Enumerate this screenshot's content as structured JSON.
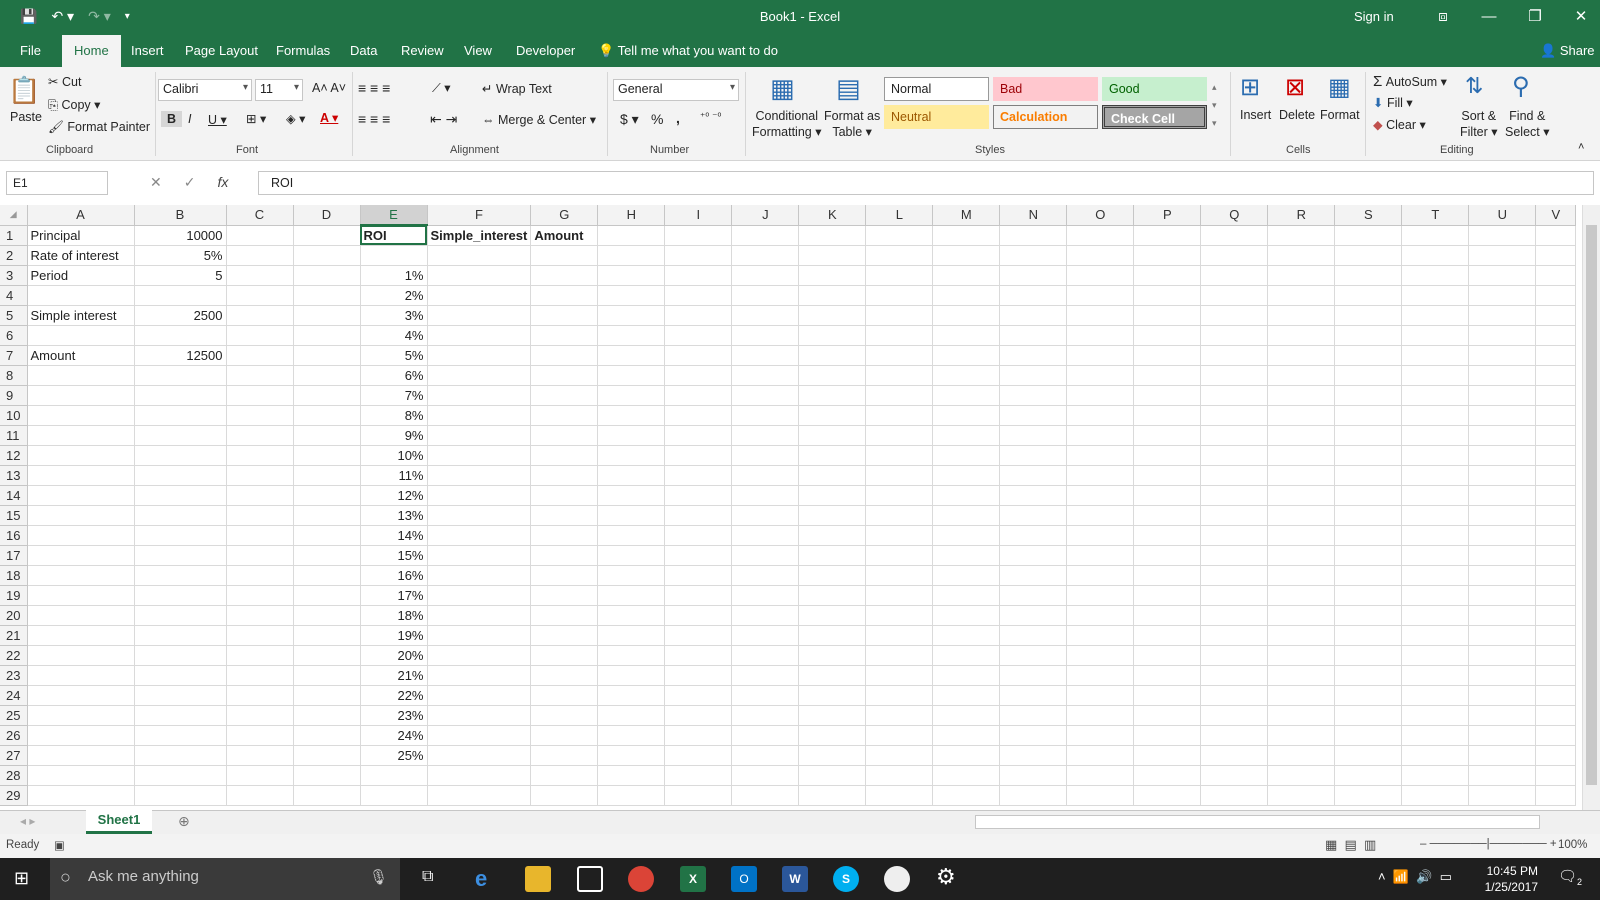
{
  "app": {
    "title": "Book1  -  Excel",
    "signin": "Sign in",
    "share": "Share"
  },
  "tabs": [
    "File",
    "Home",
    "Insert",
    "Page Layout",
    "Formulas",
    "Data",
    "Review",
    "View",
    "Developer"
  ],
  "tell_me": "Tell me what you want to do",
  "ribbon": {
    "clipboard": {
      "paste": "Paste",
      "cut": "Cut",
      "copy": "Copy",
      "format_painter": "Format Painter",
      "label": "Clipboard"
    },
    "font": {
      "name": "Calibri",
      "size": "11",
      "label": "Font"
    },
    "alignment": {
      "wrap": "Wrap Text",
      "merge": "Merge & Center",
      "label": "Alignment"
    },
    "number": {
      "format": "General",
      "label": "Number",
      "dollar": "$",
      "percent": "%",
      "comma": ","
    },
    "styles": {
      "conditional": "Conditional",
      "formatting": "Formatting",
      "format_as": "Format as",
      "table": "Table",
      "normal": "Normal",
      "bad": "Bad",
      "good": "Good",
      "neutral": "Neutral",
      "calculation": "Calculation",
      "check": "Check Cell",
      "label": "Styles"
    },
    "cells": {
      "insert": "Insert",
      "delete": "Delete",
      "format": "Format",
      "label": "Cells"
    },
    "editing": {
      "autosum": "AutoSum",
      "fill": "Fill",
      "clear": "Clear",
      "sort": "Sort &",
      "filter": "Filter",
      "find": "Find &",
      "select": "Select",
      "label": "Editing"
    }
  },
  "formula_bar": {
    "name_box": "E1",
    "value": "ROI",
    "fx": "fx"
  },
  "columns": [
    "A",
    "B",
    "C",
    "D",
    "E",
    "F",
    "G",
    "H",
    "I",
    "J",
    "K",
    "L",
    "M",
    "N",
    "O",
    "P",
    "Q",
    "R",
    "S",
    "T",
    "U",
    "V"
  ],
  "rows": [
    [
      "Principal",
      "10000",
      "",
      "",
      "ROI",
      "Simple_interest",
      "Amount"
    ],
    [
      "Rate of interest",
      "5%",
      "",
      "",
      "",
      "",
      ""
    ],
    [
      "Period",
      "5",
      "",
      "",
      "1%",
      "",
      ""
    ],
    [
      "",
      "",
      "",
      "",
      "2%",
      "",
      ""
    ],
    [
      "Simple interest",
      "2500",
      "",
      "",
      "3%",
      "",
      ""
    ],
    [
      "",
      "",
      "",
      "",
      "4%",
      "",
      ""
    ],
    [
      "Amount",
      "12500",
      "",
      "",
      "5%",
      "",
      ""
    ],
    [
      "",
      "",
      "",
      "",
      "6%",
      "",
      ""
    ],
    [
      "",
      "",
      "",
      "",
      "7%",
      "",
      ""
    ],
    [
      "",
      "",
      "",
      "",
      "8%",
      "",
      ""
    ],
    [
      "",
      "",
      "",
      "",
      "9%",
      "",
      ""
    ],
    [
      "",
      "",
      "",
      "",
      "10%",
      "",
      ""
    ],
    [
      "",
      "",
      "",
      "",
      "11%",
      "",
      ""
    ],
    [
      "",
      "",
      "",
      "",
      "12%",
      "",
      ""
    ],
    [
      "",
      "",
      "",
      "",
      "13%",
      "",
      ""
    ],
    [
      "",
      "",
      "",
      "",
      "14%",
      "",
      ""
    ],
    [
      "",
      "",
      "",
      "",
      "15%",
      "",
      ""
    ],
    [
      "",
      "",
      "",
      "",
      "16%",
      "",
      ""
    ],
    [
      "",
      "",
      "",
      "",
      "17%",
      "",
      ""
    ],
    [
      "",
      "",
      "",
      "",
      "18%",
      "",
      ""
    ],
    [
      "",
      "",
      "",
      "",
      "19%",
      "",
      ""
    ],
    [
      "",
      "",
      "",
      "",
      "20%",
      "",
      ""
    ],
    [
      "",
      "",
      "",
      "",
      "21%",
      "",
      ""
    ],
    [
      "",
      "",
      "",
      "",
      "22%",
      "",
      ""
    ],
    [
      "",
      "",
      "",
      "",
      "23%",
      "",
      ""
    ],
    [
      "",
      "",
      "",
      "",
      "24%",
      "",
      ""
    ],
    [
      "",
      "",
      "",
      "",
      "25%",
      "",
      ""
    ],
    [
      "",
      "",
      "",
      "",
      "",
      "",
      ""
    ],
    [
      "",
      "",
      "",
      "",
      "",
      "",
      ""
    ]
  ],
  "sheet": {
    "name": "Sheet1"
  },
  "status": {
    "ready": "Ready",
    "zoom": "100%"
  },
  "taskbar": {
    "search": "Ask me anything",
    "time": "10:45 PM",
    "date": "1/25/2017",
    "notifications": "2"
  },
  "colors": {
    "accent": "#217346",
    "bad_bg": "#ffc7ce",
    "good_bg": "#c6efce",
    "neutral_bg": "#ffeb9c"
  }
}
